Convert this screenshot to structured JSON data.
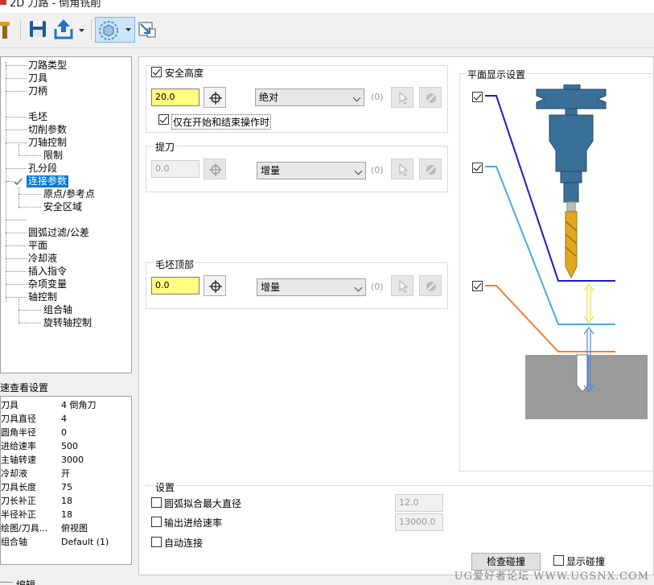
{
  "window": {
    "title": "2D 刀路 - 倒角铣削"
  },
  "tree": {
    "items": [
      {
        "label": "刀路类型"
      },
      {
        "label": "刀具"
      },
      {
        "label": "刀柄"
      },
      {
        "label": "毛坯"
      },
      {
        "label": "切削参数"
      },
      {
        "label": "刀轴控制"
      },
      {
        "label": "限制"
      },
      {
        "label": "孔分段"
      },
      {
        "label": "连接参数"
      },
      {
        "label": "原点/参考点"
      },
      {
        "label": "安全区域"
      },
      {
        "label": "圆弧过滤/公差"
      },
      {
        "label": "平面"
      },
      {
        "label": "冷却液"
      },
      {
        "label": "插入指令"
      },
      {
        "label": "杂项变量"
      },
      {
        "label": "轴控制"
      },
      {
        "label": "组合轴"
      },
      {
        "label": "旋转轴控制"
      }
    ]
  },
  "quickview": {
    "title": "速查看设置",
    "rows": [
      {
        "k": "刀具",
        "v": "4 倒角刀"
      },
      {
        "k": "刀具直径",
        "v": "4"
      },
      {
        "k": "圆角半径",
        "v": "0"
      },
      {
        "k": "进给速率",
        "v": "500"
      },
      {
        "k": "主轴转速",
        "v": "3000"
      },
      {
        "k": "冷却液",
        "v": "开"
      },
      {
        "k": "刀具长度",
        "v": "75"
      },
      {
        "k": "刀长补正",
        "v": "18"
      },
      {
        "k": "半径补正",
        "v": "18"
      },
      {
        "k": "绘图/刀具...",
        "v": "俯视图"
      },
      {
        "k": "组合轴",
        "v": "Default (1)"
      }
    ]
  },
  "bottom_label": "编辑",
  "clearance": {
    "label": "安全高度",
    "checked": true,
    "value": "20.0",
    "mode": "绝对",
    "count": "(0)",
    "only_start_end_label": "仅在开始和结束操作时",
    "only_start_end_checked": true
  },
  "retract": {
    "label": "提刀",
    "value": "0.0",
    "mode": "增量",
    "count": "(0)"
  },
  "stock_top": {
    "label": "毛坯顶部",
    "value": "0.0",
    "mode": "增量",
    "count": "(0)"
  },
  "plane_display": {
    "label": "平面显示设置"
  },
  "settings": {
    "label": "设置",
    "arc_label": "圆弧拟合最大直径",
    "arc_value": "12.0",
    "feed_label": "输出进给速率",
    "feed_value": "13000.0",
    "auto_label": "自动连接"
  },
  "check_button": "检查碰撞",
  "show_collision": "显示碰撞",
  "watermark": "UG爱好者论坛 WWW.UGSNX.COM"
}
